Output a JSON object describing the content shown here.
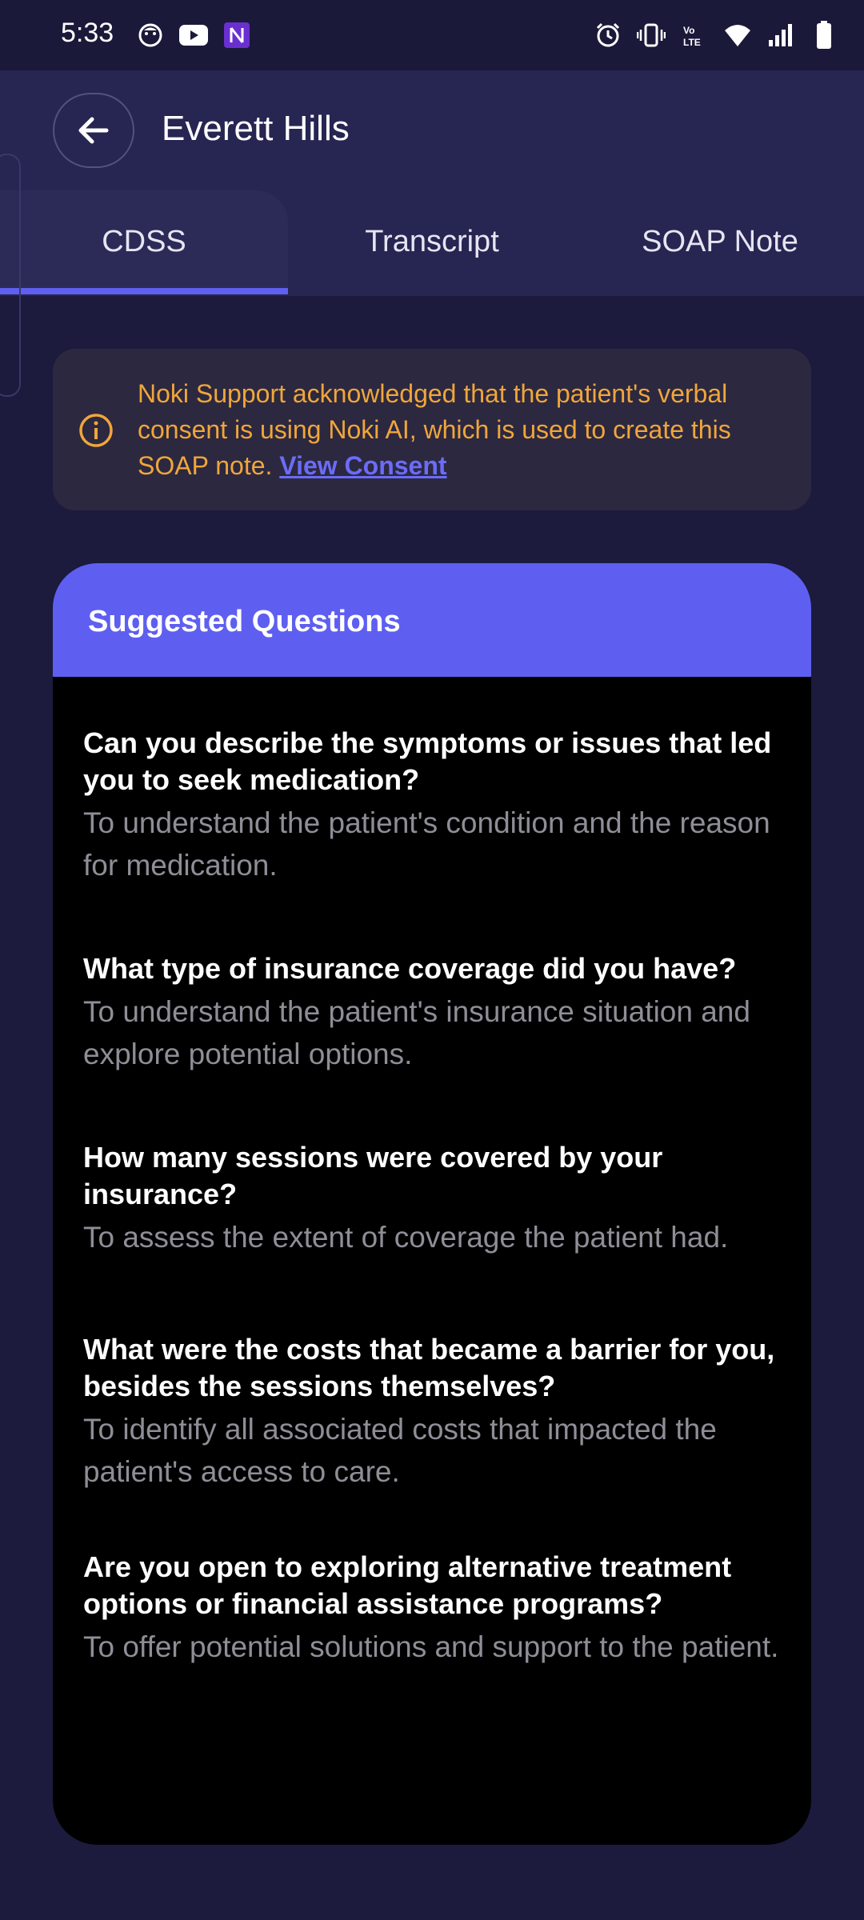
{
  "status_bar": {
    "time": "5:33"
  },
  "header": {
    "title": "Everett Hills"
  },
  "tabs": [
    {
      "label": "CDSS",
      "active": true
    },
    {
      "label": "Transcript",
      "active": false
    },
    {
      "label": "SOAP Note",
      "active": false
    }
  ],
  "consent": {
    "text": "Noki Support acknowledged that the patient's verbal consent is using Noki AI, which is used to create this SOAP note.",
    "link_label": "View Consent"
  },
  "questions_card": {
    "title": "Suggested Questions",
    "items": [
      {
        "question": "Can you describe the symptoms or issues that led you to seek medication?",
        "purpose": "To understand the patient's condition and the reason for medication."
      },
      {
        "question": "What type of insurance coverage did you have?",
        "purpose": "To understand the patient's insurance situation and explore potential options."
      },
      {
        "question": "How many sessions were covered by your insurance?",
        "purpose": "To assess the extent of coverage the patient had."
      },
      {
        "question": "What were the costs that became a barrier for you, besides the sessions themselves?",
        "purpose": "To identify all associated costs that impacted the patient's access to care."
      },
      {
        "question": "Are you open to exploring alternative treatment options or financial assistance programs?",
        "purpose": "To offer potential solutions and support to the patient."
      }
    ]
  },
  "colors": {
    "background": "#1c1a3d",
    "header": "#272551",
    "accent": "#5e5ff0",
    "warning_text": "#f0a63a",
    "card": "#000000"
  }
}
